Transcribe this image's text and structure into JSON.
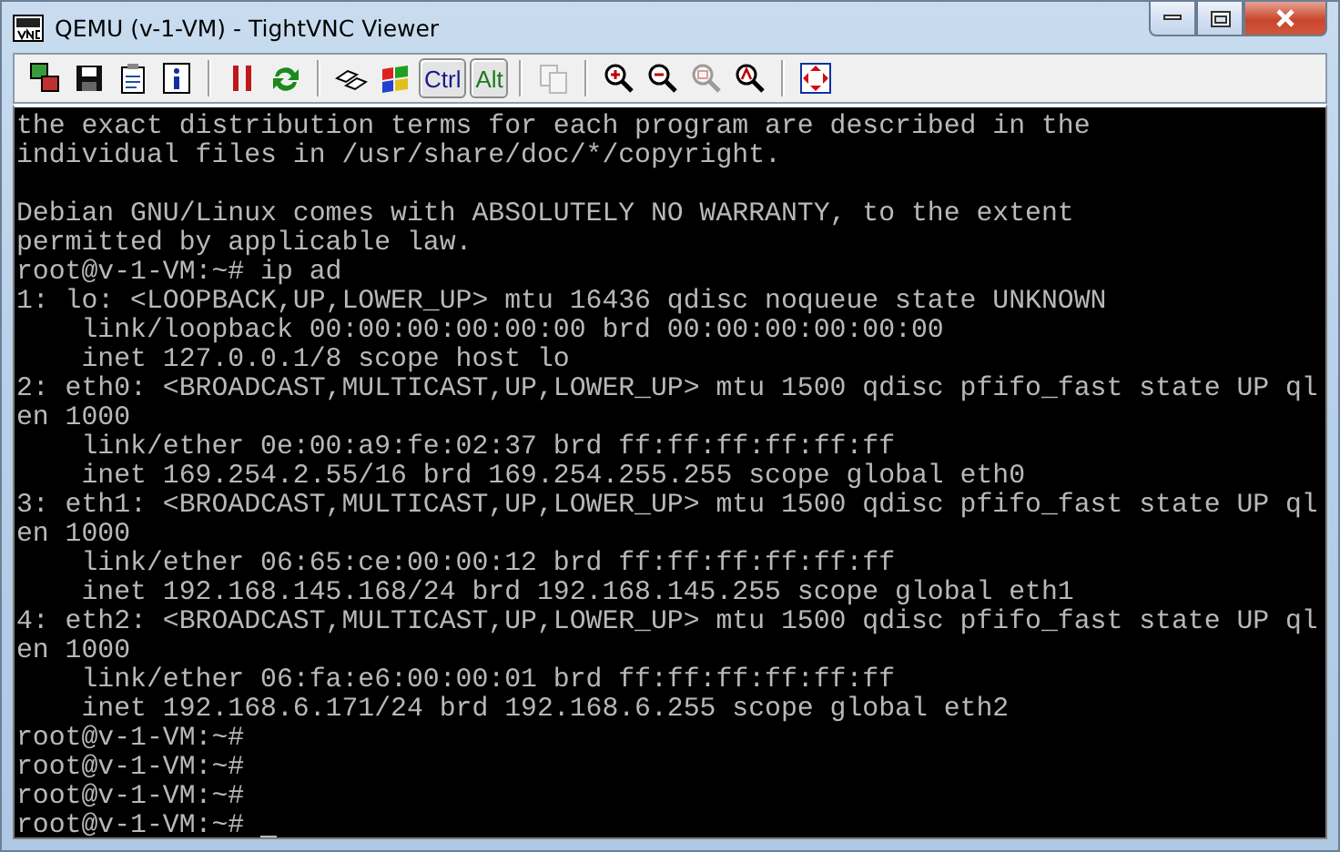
{
  "window": {
    "title": "QEMU (v-1-VM) - TightVNC Viewer"
  },
  "toolbar": [
    {
      "kind": "icon",
      "disabled": false
    },
    {
      "kind": "icon",
      "disabled": false
    },
    {
      "kind": "icon",
      "disabled": false
    },
    {
      "kind": "icon",
      "disabled": false
    },
    {
      "kind": "separator"
    },
    {
      "kind": "icon",
      "disabled": false
    },
    {
      "kind": "icon",
      "disabled": false
    },
    {
      "kind": "separator"
    },
    {
      "kind": "icon",
      "disabled": false
    },
    {
      "kind": "icon",
      "disabled": false
    },
    {
      "kind": "key",
      "label": "Ctrl",
      "color": "#1a1a8c"
    },
    {
      "kind": "key",
      "label": "Alt",
      "color": "#1a7a1a"
    },
    {
      "kind": "separator"
    },
    {
      "kind": "icon",
      "disabled": true
    },
    {
      "kind": "separator"
    },
    {
      "kind": "icon",
      "disabled": false
    },
    {
      "kind": "icon",
      "disabled": false
    },
    {
      "kind": "icon",
      "disabled": true
    },
    {
      "kind": "icon",
      "disabled": false
    },
    {
      "kind": "separator"
    },
    {
      "kind": "icon",
      "disabled": false
    }
  ],
  "terminal": {
    "cursor_visible": true,
    "blocks": [
      [
        "the exact distribution terms for each program are described in the",
        "individual files in /usr/share/doc/*/copyright."
      ],
      [
        "Debian GNU/Linux comes with ABSOLUTELY NO WARRANTY, to the extent",
        "permitted by applicable law.",
        "root@v-1-VM:~# ip ad",
        "1: lo: <LOOPBACK,UP,LOWER_UP> mtu 16436 qdisc noqueue state UNKNOWN",
        "    link/loopback 00:00:00:00:00:00 brd 00:00:00:00:00:00",
        "    inet 127.0.0.1/8 scope host lo",
        "2: eth0: <BROADCAST,MULTICAST,UP,LOWER_UP> mtu 1500 qdisc pfifo_fast state UP ql",
        "en 1000",
        "    link/ether 0e:00:a9:fe:02:37 brd ff:ff:ff:ff:ff:ff",
        "    inet 169.254.2.55/16 brd 169.254.255.255 scope global eth0",
        "3: eth1: <BROADCAST,MULTICAST,UP,LOWER_UP> mtu 1500 qdisc pfifo_fast state UP ql",
        "en 1000",
        "    link/ether 06:65:ce:00:00:12 brd ff:ff:ff:ff:ff:ff",
        "    inet 192.168.145.168/24 brd 192.168.145.255 scope global eth1",
        "4: eth2: <BROADCAST,MULTICAST,UP,LOWER_UP> mtu 1500 qdisc pfifo_fast state UP ql",
        "en 1000",
        "    link/ether 06:fa:e6:00:00:01 brd ff:ff:ff:ff:ff:ff",
        "    inet 192.168.6.171/24 brd 192.168.6.255 scope global eth2",
        "root@v-1-VM:~#",
        "root@v-1-VM:~#",
        "root@v-1-VM:~#",
        "root@v-1-VM:~# "
      ]
    ]
  }
}
